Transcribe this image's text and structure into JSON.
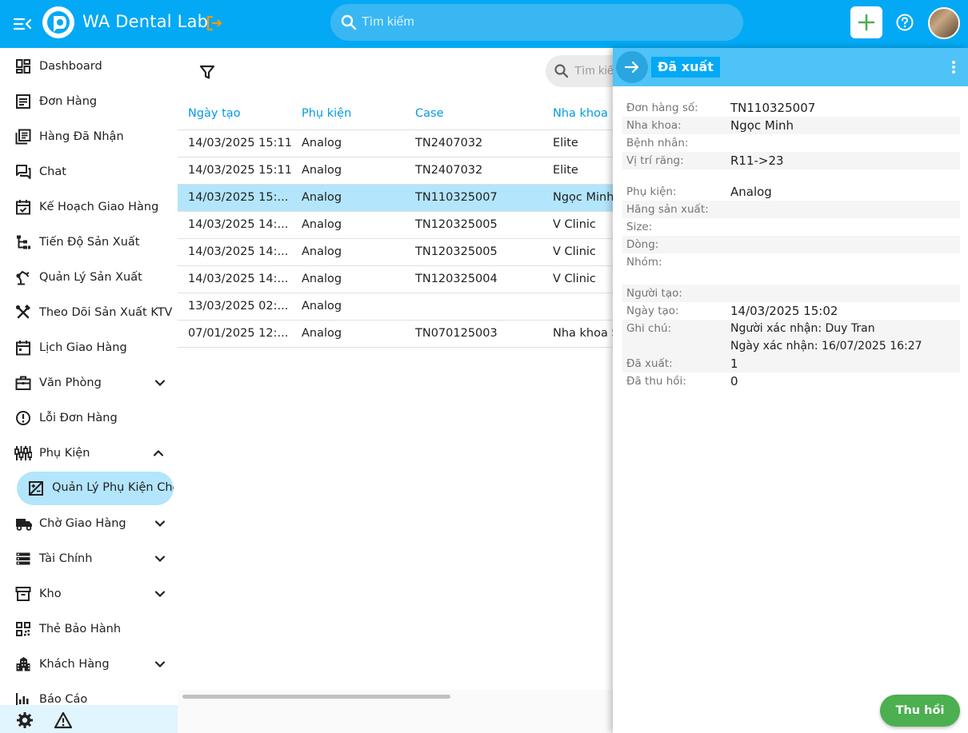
{
  "app": {
    "title": "WA Dental Lab",
    "search_placeholder": "Tìm kiếm"
  },
  "sidebar": {
    "items": [
      {
        "label": "Dashboard",
        "icon": "dashboard-icon"
      },
      {
        "label": "Đơn Hàng",
        "icon": "orders-icon"
      },
      {
        "label": "Hàng Đã Nhận",
        "icon": "received-icon"
      },
      {
        "label": "Chat",
        "icon": "chat-icon"
      },
      {
        "label": "Kế Hoạch Giao Hàng",
        "icon": "calendar-check-icon"
      },
      {
        "label": "Tiến Độ Sản Xuất",
        "icon": "hierarchy-icon"
      },
      {
        "label": "Quản Lý Sản Xuất",
        "icon": "robot-arm-icon"
      },
      {
        "label": "Theo Dõi Sản Xuất KTV",
        "icon": "tools-icon"
      },
      {
        "label": "Lịch Giao Hàng",
        "icon": "calendar-icon"
      },
      {
        "label": "Văn Phòng",
        "icon": "briefcase-icon"
      },
      {
        "label": "Lỗi Đơn Hàng",
        "icon": "error-icon"
      },
      {
        "label": "Phụ Kiện",
        "icon": "tuning-icon"
      },
      {
        "label": "Chờ Giao Hàng",
        "icon": "truck-icon"
      },
      {
        "label": "Tài Chính",
        "icon": "storage-icon"
      },
      {
        "label": "Kho",
        "icon": "archive-icon"
      },
      {
        "label": "Thẻ Bảo Hành",
        "icon": "qr-code-icon"
      },
      {
        "label": "Khách Hàng",
        "icon": "building-icon"
      },
      {
        "label": "Báo Cáo",
        "icon": "report-icon"
      }
    ],
    "sub_item": {
      "label": "Quản Lý Phụ Kiện Cho Khách Hàng",
      "icon": "accessory-manage-icon"
    }
  },
  "main": {
    "search_placeholder": "Tìm kiếm",
    "columns": [
      "Ngày tạo",
      "Phụ kiện",
      "Case",
      "Nha khoa"
    ],
    "rows": [
      {
        "date": "14/03/2025 15:11",
        "accessory": "Analog",
        "case": "TN2407032",
        "clinic": "Elite"
      },
      {
        "date": "14/03/2025 15:11",
        "accessory": "Analog",
        "case": "TN2407032",
        "clinic": "Elite"
      },
      {
        "date": "14/03/2025 15:...",
        "accessory": "Analog",
        "case": "TN110325007",
        "clinic": "Ngọc Minh"
      },
      {
        "date": "14/03/2025 14:...",
        "accessory": "Analog",
        "case": "TN120325005",
        "clinic": "V Clinic"
      },
      {
        "date": "14/03/2025 14:...",
        "accessory": "Analog",
        "case": "TN120325005",
        "clinic": "V Clinic"
      },
      {
        "date": "14/03/2025 14:...",
        "accessory": "Analog",
        "case": "TN120325004",
        "clinic": "V Clinic"
      },
      {
        "date": "13/03/2025 02:...",
        "accessory": "Analog",
        "case": "",
        "clinic": ""
      },
      {
        "date": "07/01/2025 12:...",
        "accessory": "Analog",
        "case": "TN070125003",
        "clinic": "Nha khoa Sài Gòn"
      }
    ]
  },
  "detail": {
    "status": "Đã xuất",
    "fields": {
      "order_no": {
        "label": "Đơn hàng số:",
        "value": "TN110325007"
      },
      "clinic": {
        "label": "Nha khoa:",
        "value": "Ngọc Minh"
      },
      "patient": {
        "label": "Bệnh nhân:",
        "value": ""
      },
      "tooth": {
        "label": "Vị trí răng:",
        "value": "R11->23"
      },
      "accessory": {
        "label": "Phụ kiện:",
        "value": "Analog"
      },
      "maker": {
        "label": "Hãng sản xuất:",
        "value": ""
      },
      "size": {
        "label": "Size:",
        "value": ""
      },
      "line": {
        "label": "Dòng:",
        "value": ""
      },
      "group": {
        "label": "Nhóm:",
        "value": ""
      },
      "creator": {
        "label": "Người tạo:",
        "value": ""
      },
      "created": {
        "label": "Ngày tạo:",
        "value": "14/03/2025 15:02"
      },
      "note": {
        "label": "Ghi chú:",
        "value": "Người xác nhận: Duy Tran",
        "value2": "Ngày xác nhận: 16/07/2025 16:27"
      },
      "exported": {
        "label": "Đã xuất:",
        "value": "1"
      },
      "recalled": {
        "label": "Đã thu hồi:",
        "value": "0"
      }
    },
    "recall_button": "Thu hồi"
  },
  "colors": {
    "primary": "#03a9f4",
    "selected_row": "#b3e5fc",
    "header_text": "#039be5",
    "recall": "#4caf50",
    "logout_accent": "#ff9800"
  }
}
